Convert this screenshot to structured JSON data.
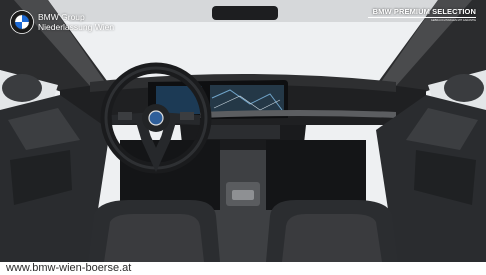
{
  "brand": {
    "logo_icon": "bmw-roundel-icon",
    "dealer_line1": "BMW Group",
    "dealer_line2": "Niederlassung Wien"
  },
  "badge": {
    "title": "BMW PREMIUM SELECTION",
    "tagline": "GEBRAUCHTWAGEN MIT GARANTIE"
  },
  "footer": {
    "url": "www.bmw-wien-boerse.at"
  },
  "photo": {
    "subject": "car-interior",
    "colors": {
      "leather": "#2a2c2f",
      "alcantara": "#3a3b3e",
      "dash": "#1a1b1d",
      "headliner": "#cfd1d3",
      "window": "#eef0f2",
      "screen": "#243847"
    }
  }
}
